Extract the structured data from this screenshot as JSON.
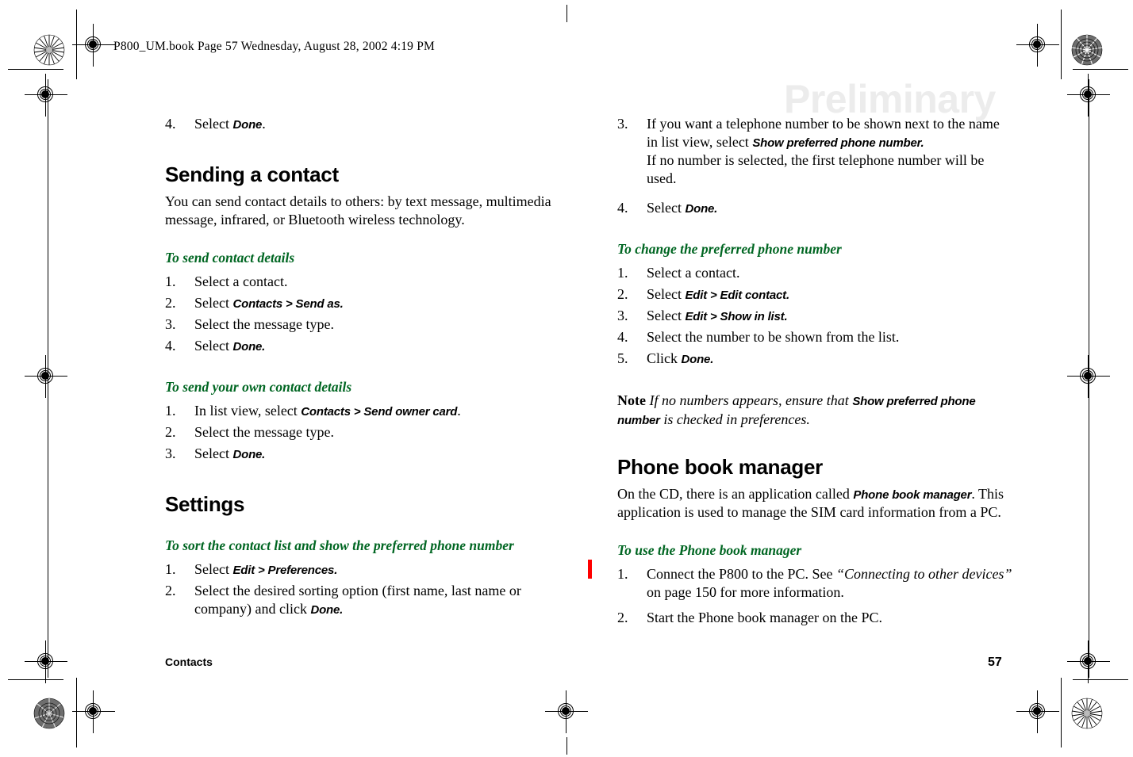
{
  "page": {
    "header_line": "P800_UM.book  Page 57  Wednesday, August 28, 2002  4:19 PM",
    "watermark": "Preliminary",
    "footer_left": "Contacts",
    "page_number": "57",
    "accent_green": "#006622",
    "change_bar_color": "#ff0000",
    "watermark_color": "#ececec"
  },
  "left_column": {
    "leading_step": {
      "num": "4.",
      "prefix": "Select ",
      "ui": "Done",
      "suffix": "."
    },
    "section_sending": {
      "heading": "Sending a contact",
      "intro": "You can send contact details to others: by text message, multimedia message, infrared, or Bluetooth wireless technology.",
      "proc_send_details": {
        "title": "To send contact details",
        "steps": [
          {
            "num": "1.",
            "prefix": "Select a contact.",
            "ui": "",
            "suffix": ""
          },
          {
            "num": "2.",
            "prefix": "Select ",
            "ui": "Contacts > Send as.",
            "suffix": ""
          },
          {
            "num": "3.",
            "prefix": "Select the message type.",
            "ui": "",
            "suffix": ""
          },
          {
            "num": "4.",
            "prefix": "Select ",
            "ui": "Done.",
            "suffix": ""
          }
        ]
      },
      "proc_send_own": {
        "title": "To send your own contact details",
        "steps": [
          {
            "num": "1.",
            "prefix": "In list view, select ",
            "ui": "Contacts > Send owner card",
            "suffix": "."
          },
          {
            "num": "2.",
            "prefix": "Select the message type.",
            "ui": "",
            "suffix": ""
          },
          {
            "num": "3.",
            "prefix": "Select ",
            "ui": "Done.",
            "suffix": ""
          }
        ]
      }
    },
    "section_settings": {
      "heading": "Settings",
      "proc_sort": {
        "title": "To sort the contact list and show the preferred phone number",
        "steps": [
          {
            "num": "1.",
            "prefix": "Select ",
            "ui": "Edit > Preferences.",
            "suffix": ""
          },
          {
            "num": "2.",
            "prefix": "Select the desired sorting option (first name, last name or company) and click ",
            "ui": "Done.",
            "suffix": ""
          }
        ]
      }
    }
  },
  "right_column": {
    "step3": {
      "num": "3.",
      "prefix": "If you want a telephone number to be shown next to the name in list view, select ",
      "ui": "Show preferred phone number.",
      "continuation": "If no number is selected, the first telephone number will be used."
    },
    "step4": {
      "num": "4.",
      "prefix": "Select ",
      "ui": "Done.",
      "suffix": ""
    },
    "proc_change_preferred": {
      "title": "To change the preferred phone number",
      "steps": [
        {
          "num": "1.",
          "prefix": "Select a contact.",
          "ui": "",
          "suffix": ""
        },
        {
          "num": "2.",
          "prefix": "Select ",
          "ui": "Edit > Edit contact.",
          "suffix": ""
        },
        {
          "num": "3.",
          "prefix": "Select ",
          "ui": "Edit > Show in list.",
          "suffix": ""
        },
        {
          "num": "4.",
          "prefix": "Select the number to be shown from the list.",
          "ui": "",
          "suffix": ""
        },
        {
          "num": "5.",
          "prefix": "Click ",
          "ui": "Done.",
          "suffix": ""
        }
      ]
    },
    "note": {
      "lead": "Note",
      "text_before": " If no numbers appears, ensure that ",
      "ui": "Show preferred phone number",
      "text_after": " is checked in preferences."
    },
    "section_pbm": {
      "heading": "Phone book manager",
      "intro_before": "On the CD, there is an application called ",
      "intro_ui": "Phone book manager",
      "intro_after": ". This application is used to manage the SIM card information from a PC.",
      "proc_use": {
        "title": "To use the Phone book manager",
        "steps": [
          {
            "num": "1.",
            "prefix": "Connect the P800 to the PC. See ",
            "italic": "“Connecting to other devices”",
            "suffix": " on page 150 for more information."
          },
          {
            "num": "2.",
            "prefix": "Start the Phone book manager on the PC.",
            "italic": "",
            "suffix": ""
          }
        ]
      }
    }
  }
}
